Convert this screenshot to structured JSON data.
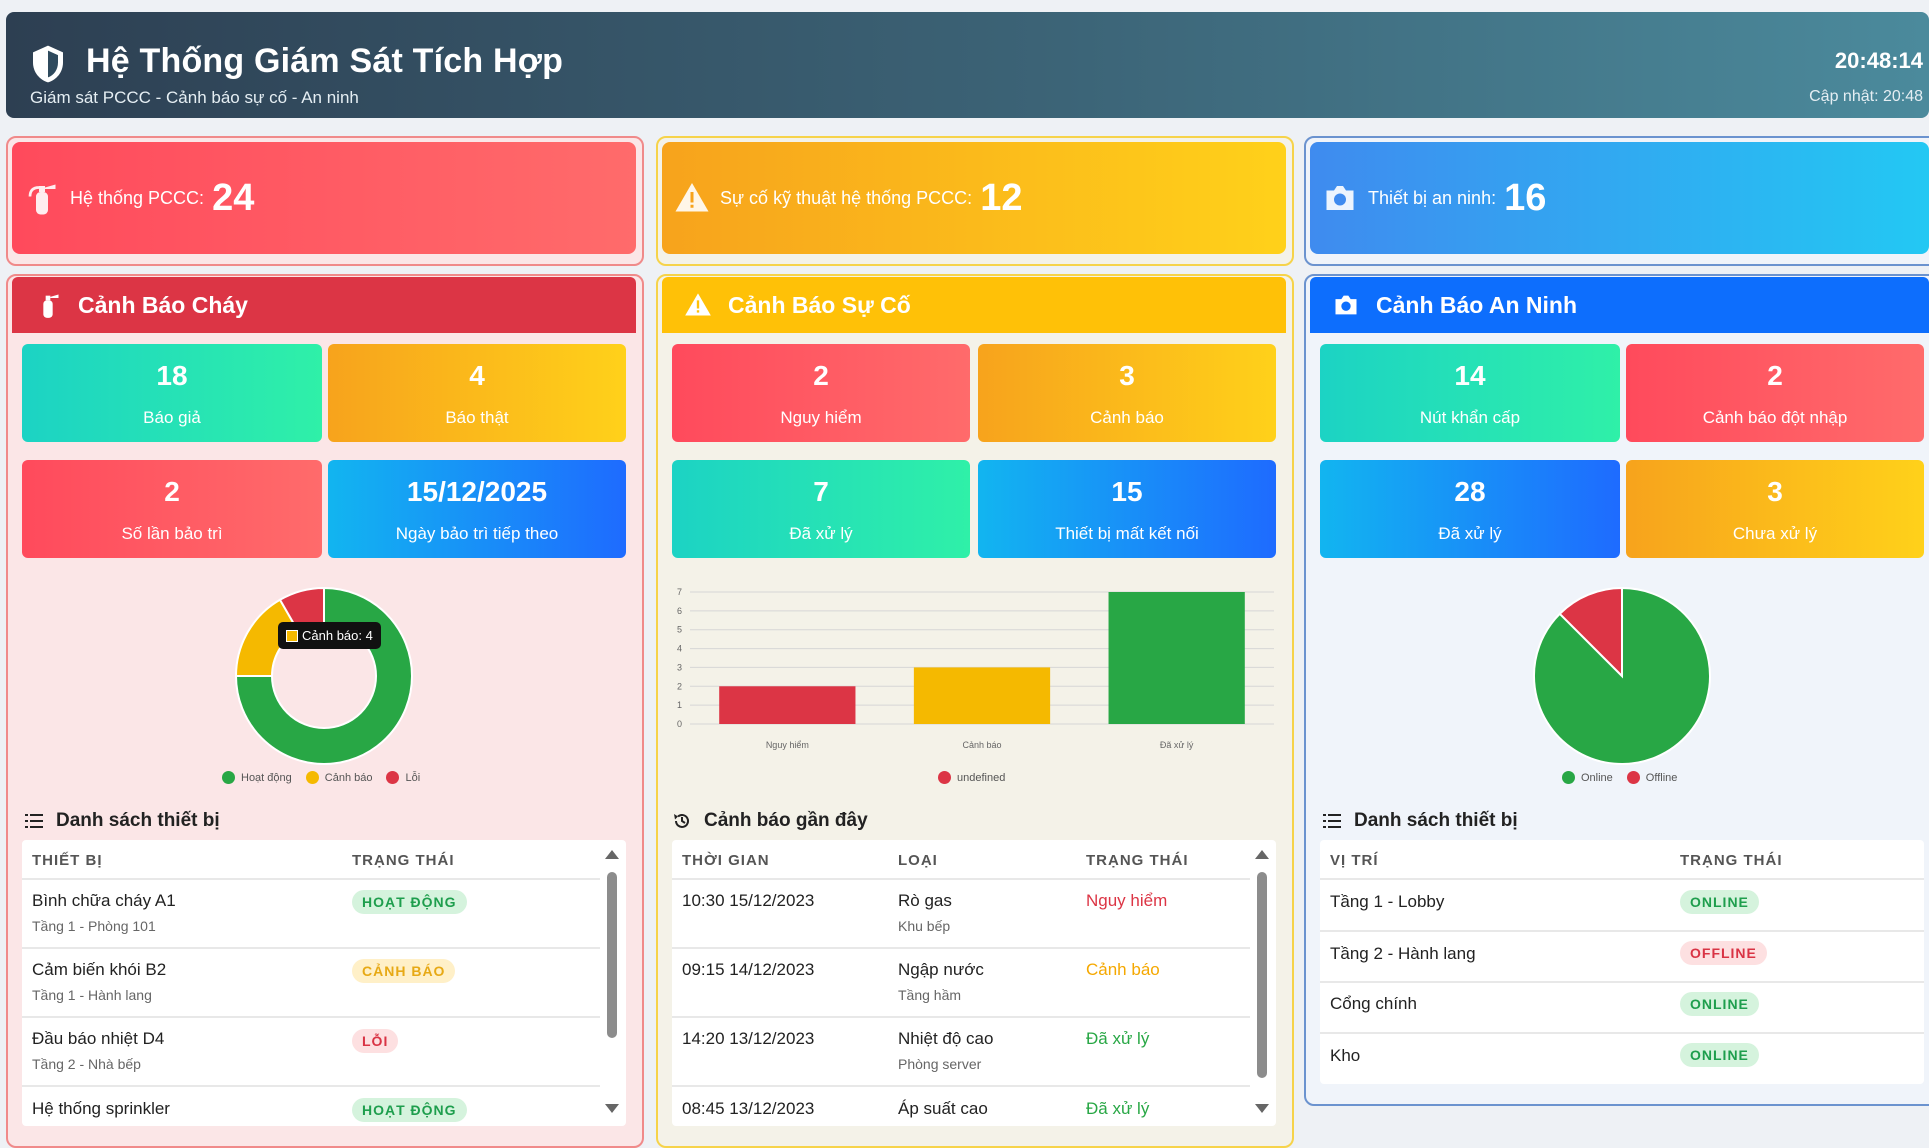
{
  "header": {
    "title": "Hệ Thống Giám Sát Tích Hợp",
    "subtitle": "Giám sát PCCC - Cảnh báo sự cố - An ninh",
    "clock": "20:48:14",
    "updated": "Cập nhật: 20:48"
  },
  "summary": [
    {
      "label": "Hệ thống PCCC:",
      "value": "24",
      "icon": "fire-extinguisher-icon"
    },
    {
      "label": "Sự cố kỹ thuật hệ thống PCCC:",
      "value": "12",
      "icon": "warning-triangle-icon"
    },
    {
      "label": "Thiết bị an ninh:",
      "value": "16",
      "icon": "camera-icon"
    }
  ],
  "fire": {
    "title": "Cảnh Báo Cháy",
    "stats": [
      {
        "n": "18",
        "l": "Báo giả"
      },
      {
        "n": "4",
        "l": "Báo thật"
      },
      {
        "n": "2",
        "l": "Số lần bảo trì"
      },
      {
        "n": "15/12/2025",
        "l": "Ngày bảo trì tiếp theo"
      }
    ],
    "tooltip": "Cảnh báo: 4",
    "legend": [
      "Hoạt động",
      "Cảnh báo",
      "Lỗi"
    ],
    "list_title": "Danh sách thiết bị",
    "columns": [
      "THIẾT BỊ",
      "TRẠNG THÁI"
    ],
    "rows": [
      {
        "name": "Bình chữa cháy A1",
        "loc": "Tầng 1 - Phòng 101",
        "status": "HOẠT ĐỘNG"
      },
      {
        "name": "Cảm biến khói B2",
        "loc": "Tầng 1 - Hành lang",
        "status": "CẢNH BÁO"
      },
      {
        "name": "Đầu báo nhiệt D4",
        "loc": "Tầng 2 - Nhà bếp",
        "status": "LỖI"
      },
      {
        "name": "Hệ thống sprinkler",
        "loc": "",
        "status": "HOẠT ĐỘNG"
      }
    ]
  },
  "incident": {
    "title": "Cảnh Báo Sự Cố",
    "stats": [
      {
        "n": "2",
        "l": "Nguy hiểm"
      },
      {
        "n": "3",
        "l": "Cảnh báo"
      },
      {
        "n": "7",
        "l": "Đã xử lý"
      },
      {
        "n": "15",
        "l": "Thiết bị mất kết nối"
      }
    ],
    "legend": [
      "undefined"
    ],
    "list_title": "Cảnh báo gần đây",
    "columns": [
      "THỜI GIAN",
      "LOẠI",
      "TRẠNG THÁI"
    ],
    "rows": [
      {
        "time": "10:30 15/12/2023",
        "type": "Rò gas",
        "loc": "Khu bếp",
        "status": "Nguy hiểm"
      },
      {
        "time": "09:15 14/12/2023",
        "type": "Ngập nước",
        "loc": "Tầng hầm",
        "status": "Cảnh báo"
      },
      {
        "time": "14:20 13/12/2023",
        "type": "Nhiệt độ cao",
        "loc": "Phòng server",
        "status": "Đã xử lý"
      },
      {
        "time": "08:45 13/12/2023",
        "type": "Áp suất cao",
        "loc": "",
        "status": "Đã xử lý"
      }
    ]
  },
  "security": {
    "title": "Cảnh Báo An Ninh",
    "stats": [
      {
        "n": "14",
        "l": "Nút khẩn cấp"
      },
      {
        "n": "2",
        "l": "Cảnh báo đột nhập"
      },
      {
        "n": "28",
        "l": "Đã xử lý"
      },
      {
        "n": "3",
        "l": "Chưa xử lý"
      }
    ],
    "legend": [
      "Online",
      "Offline"
    ],
    "list_title": "Danh sách thiết bị",
    "columns": [
      "VỊ TRÍ",
      "TRẠNG THÁI"
    ],
    "rows": [
      {
        "loc": "Tầng 1 - Lobby",
        "status": "ONLINE"
      },
      {
        "loc": "Tầng 2 - Hành lang",
        "status": "OFFLINE"
      },
      {
        "loc": "Cổng chính",
        "status": "ONLINE"
      },
      {
        "loc": "Kho",
        "status": "ONLINE"
      }
    ]
  },
  "chart_data": [
    {
      "type": "pie",
      "variant": "doughnut",
      "categories": [
        "Hoạt động",
        "Cảnh báo",
        "Lỗi"
      ],
      "values": [
        18,
        4,
        2
      ],
      "colors": [
        "#28a745",
        "#f5b900",
        "#dc3545"
      ]
    },
    {
      "type": "bar",
      "categories": [
        "Nguy hiểm",
        "Cảnh báo",
        "Đã xử lý"
      ],
      "values": [
        2,
        3,
        7
      ],
      "colors": [
        "#dc3545",
        "#f5b900",
        "#28a745"
      ],
      "series": [
        {
          "name": "undefined",
          "values": [
            2,
            3,
            7
          ]
        }
      ],
      "ylim": [
        0,
        7
      ],
      "yticks": [
        0,
        1,
        2,
        3,
        4,
        5,
        6,
        7
      ]
    },
    {
      "type": "pie",
      "categories": [
        "Online",
        "Offline"
      ],
      "values": [
        14,
        2
      ],
      "colors": [
        "#28a745",
        "#dc3545"
      ]
    }
  ],
  "colors": {
    "green": "#28a745",
    "yellow": "#f5b900",
    "red": "#dc3545"
  }
}
